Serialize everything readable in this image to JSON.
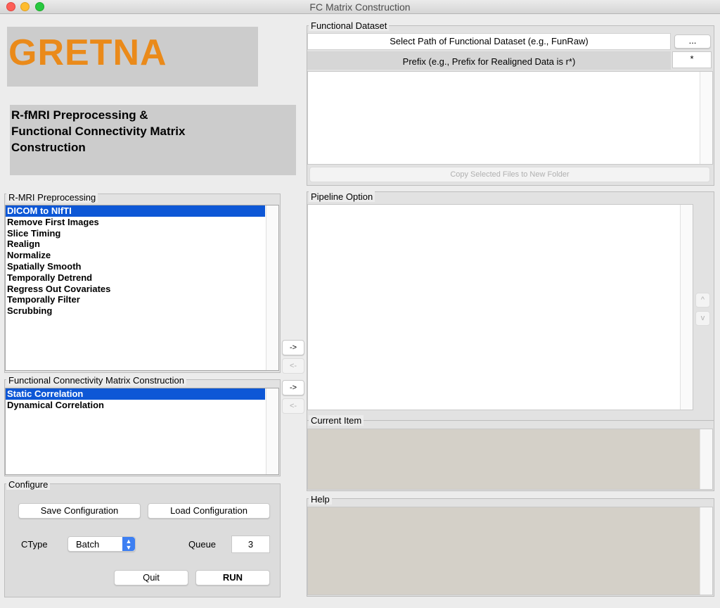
{
  "window": {
    "title": "FC Matrix Construction"
  },
  "branding": {
    "logo_text": "GRETNA",
    "subtitle_lines": [
      "R-fMRI Preprocessing &",
      "Functional Connectivity Matrix",
      "Construction"
    ]
  },
  "preprocessing": {
    "title": "R-MRI Preprocessing",
    "items": [
      "DICOM to NIfTI",
      "Remove First Images",
      "Slice Timing",
      "Realign",
      "Normalize",
      "Spatially Smooth",
      "Temporally Detrend",
      "Regress Out Covariates",
      "Temporally Filter",
      "Scrubbing"
    ],
    "selected_index": 0,
    "add_label": "->",
    "remove_label": "<-"
  },
  "fc_construction": {
    "title": "Functional Connectivity Matrix Construction",
    "items": [
      "Static Correlation",
      "Dynamical Correlation"
    ],
    "selected_index": 0,
    "add_label": "->",
    "remove_label": "<-"
  },
  "configure": {
    "title": "Configure",
    "save_label": "Save Configuration",
    "load_label": "Load Configuration",
    "ctype_label": "CType",
    "ctype_value": "Batch",
    "queue_label": "Queue",
    "queue_value": "3",
    "quit_label": "Quit",
    "run_label": "RUN"
  },
  "functional_dataset": {
    "title": "Functional Dataset",
    "path_label": "Select Path of Functional Dataset (e.g., FunRaw)",
    "browse_label": "...",
    "prefix_label": "Prefix (e.g., Prefix for Realigned Data is r*)",
    "prefix_value": "*",
    "copy_label": "Copy Selected Files to New Folder"
  },
  "pipeline": {
    "title": "Pipeline Option",
    "up_label": "^",
    "down_label": "v"
  },
  "current_item": {
    "title": "Current Item"
  },
  "help": {
    "title": "Help"
  },
  "colors": {
    "logo": "#ea8a1a",
    "selection": "#0d57d6"
  }
}
